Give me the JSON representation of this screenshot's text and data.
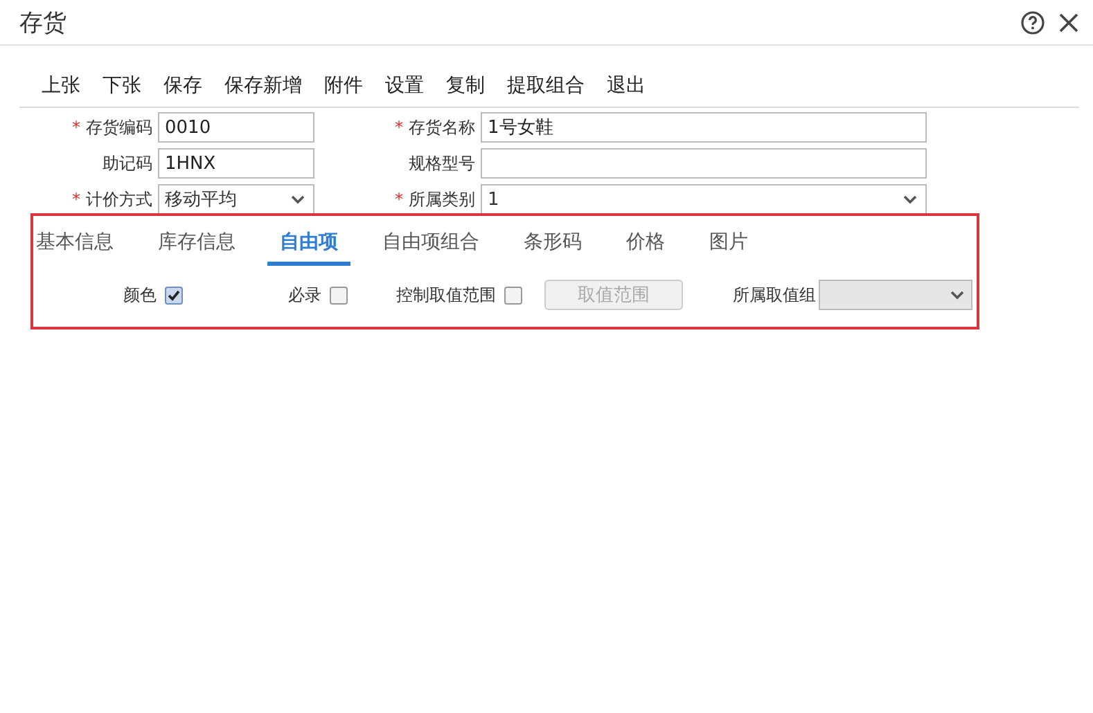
{
  "window": {
    "title": "存货"
  },
  "toolbar": [
    "上张",
    "下张",
    "保存",
    "保存新增",
    "附件",
    "设置",
    "复制",
    "提取组合",
    "退出"
  ],
  "fields": [
    {
      "marker": "*",
      "label": "存货编码",
      "kind": "text",
      "value": "0010"
    },
    {
      "marker": "*",
      "label": "存货名称",
      "kind": "text",
      "value": "1号女鞋"
    },
    {
      "label": "助记码",
      "kind": "text",
      "value": "1HNX"
    },
    {
      "label": "规格型号",
      "kind": "text"
    },
    {
      "marker": "*",
      "label": "计价方式",
      "kind": "select",
      "value": "移动平均"
    },
    {
      "marker": "*",
      "label": "所属类别",
      "kind": "select",
      "value": "1"
    }
  ],
  "tabs": [
    {
      "label": "基本信息",
      "selected": false
    },
    {
      "label": "库存信息",
      "selected": false
    },
    {
      "label": "自由项",
      "selected": true
    },
    {
      "label": "自由项组合",
      "selected": false
    },
    {
      "label": "条形码",
      "selected": false
    },
    {
      "label": "价格",
      "selected": false
    },
    {
      "label": "图片",
      "selected": false
    }
  ],
  "options": [
    {
      "kind": "checkbox",
      "label": "颜色",
      "checked": true
    },
    {
      "kind": "checkbox",
      "label": "必录",
      "checked": false
    },
    {
      "kind": "checkbox",
      "label": "控制取值范围",
      "checked": false
    },
    {
      "kind": "button",
      "label": "取值范围",
      "disabled": true
    },
    {
      "kind": "select",
      "label": "所属取值组",
      "disabled": true
    }
  ]
}
